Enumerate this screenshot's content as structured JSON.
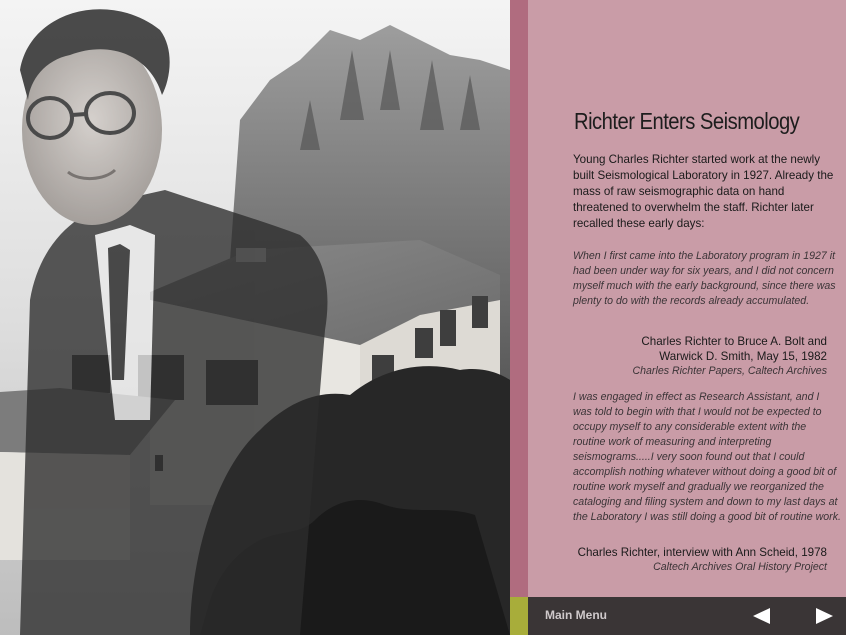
{
  "article": {
    "title": "Richter Enters Seismology",
    "intro": "Young Charles Richter started work at the newly built Seismological Laboratory in 1927. Already the mass of raw seismographic data on hand threatened to overwhelm the staff. Richter later recalled these early days:",
    "quote1": "When I first came into the Laboratory program in 1927 it had been under way for six years, and I did not concern myself much with the early background, since there was plenty to do with the records already accumulated.",
    "cite1_line1": "Charles Richter to Bruce A. Bolt and",
    "cite1_line2": "Warwick D. Smith, May 15, 1982",
    "cite1_source": "Charles Richter Papers, Caltech Archives",
    "quote2": "I was engaged in effect as Research Assistant, and I was told to begin with that I would not be expected to occupy myself to any considerable extent with the routine work of measuring and interpreting seismograms.....I very soon found out that I could accomplish nothing whatever without doing a good bit of routine work myself and gradually we reorganized the cataloging and filing system and down to my last days at the Laboratory I was still doing a good bit of routine work.",
    "cite2_line1": "Charles Richter, interview with Ann Scheid, 1978",
    "cite2_source": "Caltech Archives Oral History Project"
  },
  "nav": {
    "main_menu": "Main Menu",
    "prev_icon": "triangle-left-icon",
    "next_icon": "triangle-right-icon"
  },
  "colors": {
    "panel": "#c99ca7",
    "stripe": "#b06c7f",
    "bar": "#3a3536",
    "accent": "#a8ad3a",
    "arrow": "#ffffff"
  }
}
